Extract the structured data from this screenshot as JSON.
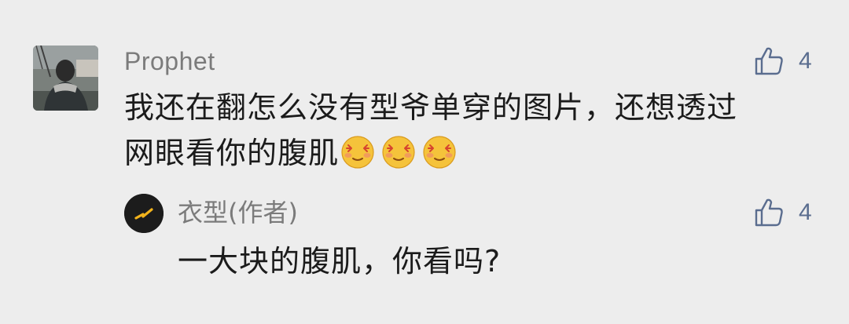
{
  "comment": {
    "username": "Prophet",
    "avatar": "user-photo-avatar",
    "like_count": "4",
    "text_line1": "我还在翻怎么没有型爷单穿的图片，还想透过",
    "text_line2": "网眼看你的腹肌",
    "emojis": [
      "heart-eyes-emoji",
      "heart-eyes-emoji",
      "heart-eyes-emoji"
    ]
  },
  "reply": {
    "author_name": "衣型(作者)",
    "avatar": "brand-logo-avatar",
    "like_count": "4",
    "text": "一大块的腹肌，你看吗?"
  },
  "colors": {
    "background": "#ededed",
    "name": "#7b7b7b",
    "like": "#5a6d8f",
    "text": "#1b1b1b",
    "logo_accent": "#f2b31c"
  },
  "icons": {
    "like": "thumbs-up-icon"
  }
}
